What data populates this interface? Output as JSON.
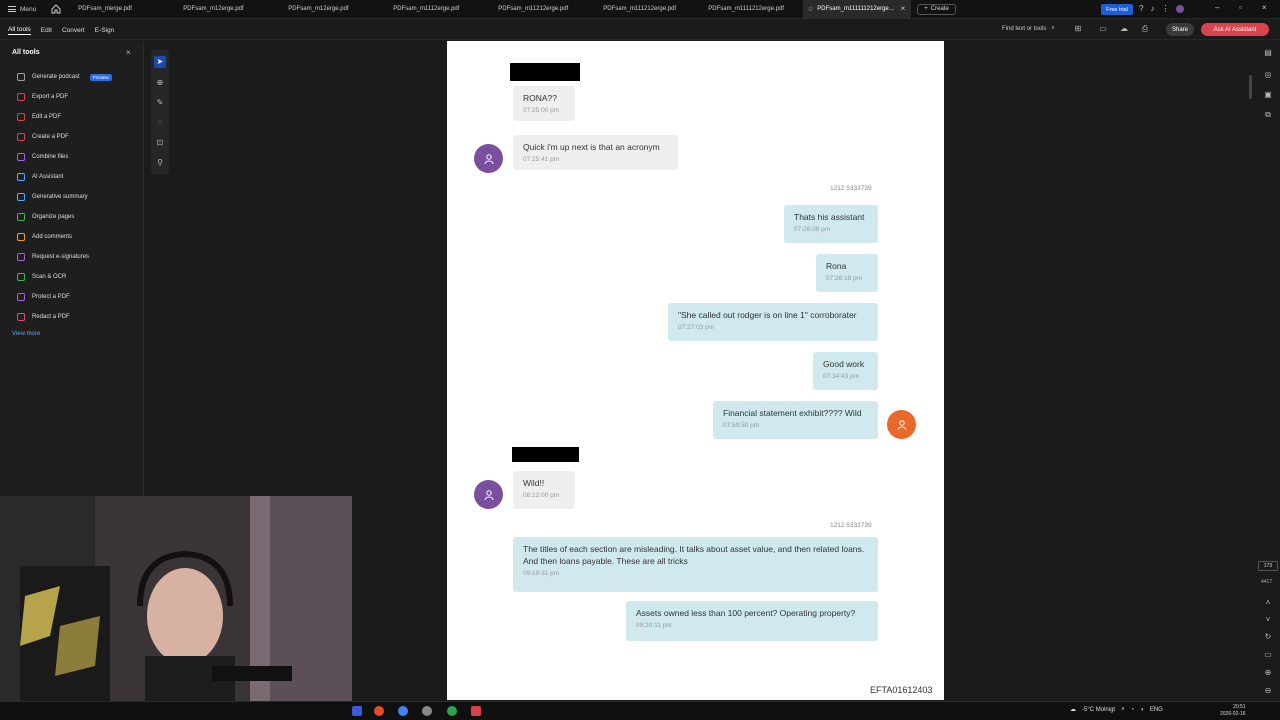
{
  "tabbar": {
    "menu_label": "Menu",
    "tabs": [
      {
        "label": "PDFsam_merge.pdf"
      },
      {
        "label": "PDFsam_m12erge.pdf"
      },
      {
        "label": "PDFsam_m12erge.pdf"
      },
      {
        "label": "PDFsam_m1112erge.pdf"
      },
      {
        "label": "PDFsam_m11212erge.pdf"
      },
      {
        "label": "PDFsam_m111212erge.pdf"
      },
      {
        "label": "PDFsam_m1111212erge.pdf"
      },
      {
        "label": "PDFsam_m111111212erge..."
      }
    ],
    "create_label": "Create",
    "free_trial_label": "Free trial"
  },
  "toolbar": {
    "tabs": [
      "All tools",
      "Edit",
      "Convert",
      "E-Sign"
    ],
    "find_label": "Find text or tools",
    "share_label": "Share",
    "ai_label": "Ask AI Assistant"
  },
  "left_panel": {
    "title": "All tools",
    "items": [
      {
        "label": "Generate podcast",
        "badge": "Preview",
        "color": "#9aa0a6"
      },
      {
        "label": "Export a PDF",
        "color": "#d9434e"
      },
      {
        "label": "Edit a PDF",
        "color": "#d9434e"
      },
      {
        "label": "Create a PDF",
        "color": "#d9434e"
      },
      {
        "label": "Combine files",
        "color": "#a463d6"
      },
      {
        "label": "AI Assistant",
        "color": "#5ea4ff"
      },
      {
        "label": "Generative summary",
        "color": "#5ea4ff"
      },
      {
        "label": "Organize pages",
        "color": "#4caf50"
      },
      {
        "label": "Add comments",
        "color": "#e6a323"
      },
      {
        "label": "Request e-signatures",
        "color": "#a463d6"
      },
      {
        "label": "Scan & OCR",
        "color": "#4caf50"
      },
      {
        "label": "Protect a PDF",
        "color": "#a463d6"
      },
      {
        "label": "Redact a PDF",
        "color": "#e0457b"
      }
    ],
    "view_more": "View more"
  },
  "document": {
    "messages": [
      {
        "side": "left",
        "text": "RONA??",
        "time": "07:25:00 pm"
      },
      {
        "side": "left",
        "text": "Quick i'm up next is that an acronym",
        "time": "07:25:41 pm"
      },
      {
        "side": "right",
        "text": "Thats his assistant",
        "time": "07:26:08 pm"
      },
      {
        "side": "right",
        "text": "Rona",
        "time": "07:26:18 pm"
      },
      {
        "side": "right",
        "text": "\"She called out rodger is on line 1\"  corroborater",
        "time": "07:27:03 pm"
      },
      {
        "side": "right",
        "text": "Good work",
        "time": "07:34:43 pm"
      },
      {
        "side": "right",
        "text": "Financial statement exhibit????  Wild",
        "time": "07:59:50 pm"
      },
      {
        "side": "left",
        "text": "Wild!!",
        "time": "08:12:00 pm"
      },
      {
        "side": "right",
        "text": "The titles of each section are misleading.   It talks about asset value,  and then related loans.  And then loans payable.  These are all tricks",
        "time": "09:19:31 pm"
      },
      {
        "side": "right",
        "text": "Assets owned less than 100 percent?   Operating property?",
        "time": "09:20:11 pm"
      }
    ],
    "sender_label_1": "1212 5333739",
    "sender_label_2": "1212 5333739",
    "footer_code": "EFTA01612403"
  },
  "right_rail": {
    "page_number": "173",
    "page_total": "4417"
  },
  "taskbar": {
    "weather": "-5°C  Molnigt",
    "lang": "ENG",
    "time": "20:51",
    "date": "2026-02-16"
  }
}
